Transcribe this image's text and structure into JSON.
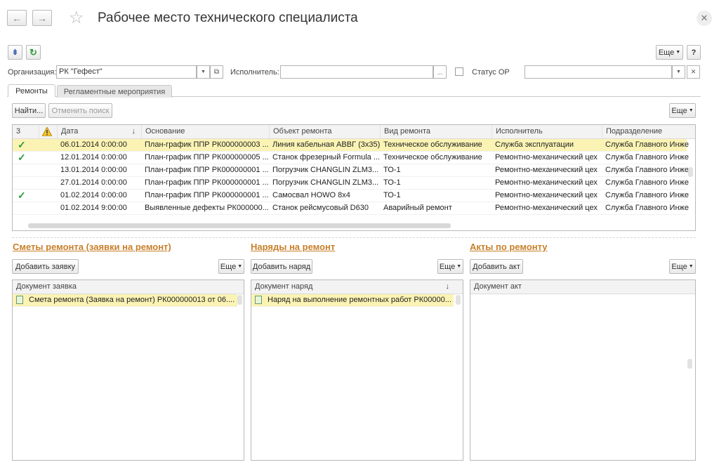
{
  "window": {
    "title": "Рабочее место технического специалиста",
    "more_label": "Еще",
    "help_label": "?"
  },
  "filters": {
    "organization_label": "Организация:",
    "organization_value": "РК \"Гефест\"",
    "executor_label": "Исполнитель:",
    "executor_value": "",
    "status_label": "Статус ОР",
    "status_value": ""
  },
  "tabs": [
    {
      "label": "Ремонты"
    },
    {
      "label": "Регламентные мероприятия"
    }
  ],
  "repairs": {
    "find_label": "Найти...",
    "cancel_search_label": "Отменить поиск",
    "more_label": "Еще",
    "columns": [
      "3",
      "",
      "Дата",
      "Основание",
      "Объект ремонта",
      "Вид ремонта",
      "Исполнитель",
      "Подразделение"
    ],
    "rows": [
      {
        "done": "✓",
        "date": "06.01.2014 0:00:00",
        "basis": "План-график ППР РК000000003 ...",
        "object": "Линия кабельная АВВГ (3х35)",
        "type": "Техническое обслуживание",
        "executor": "Служба эксплуатации",
        "dept": "Служба Главного Инженера"
      },
      {
        "done": "✓",
        "date": "12.01.2014 0:00:00",
        "basis": "План-график ППР РК000000005 ...",
        "object": "Станок фрезерный Formula ...",
        "type": "Техническое обслуживание",
        "executor": "Ремонтно-механический цех",
        "dept": "Служба Главного Инженера"
      },
      {
        "done": "",
        "date": "13.01.2014 0:00:00",
        "basis": "План-график ППР РК000000001 ...",
        "object": "Погрузчик CHANGLIN ZLM3...",
        "type": "ТО-1",
        "executor": "Ремонтно-механический цех",
        "dept": "Служба Главного Инженера"
      },
      {
        "done": "",
        "date": "27.01.2014 0:00:00",
        "basis": "План-график ППР РК000000001 ...",
        "object": "Погрузчик CHANGLIN ZLM3...",
        "type": "ТО-1",
        "executor": "Ремонтно-механический цех",
        "dept": "Служба Главного Инженера"
      },
      {
        "done": "✓",
        "date": "01.02.2014 0:00:00",
        "basis": "План-график ППР РК000000001 ...",
        "object": "Самосвал HOWO 8x4",
        "type": "ТО-1",
        "executor": "Ремонтно-механический цех",
        "dept": "Служба Главного Инженера"
      },
      {
        "done": "",
        "date": "01.02.2014 9:00:00",
        "basis": "Выявленные дефекты РК000000...",
        "object": "Станок рейсмусовый D630",
        "type": "Аварийный ремонт",
        "executor": "Ремонтно-механический цех",
        "dept": "Служба Главного Инженера"
      }
    ]
  },
  "estimates": {
    "title": "Сметы ремонта (заявки на ремонт)",
    "add_label": "Добавить заявку",
    "more_label": "Еще",
    "column": "Документ заявка",
    "rows": [
      "Смета ремонта (Заявка на ремонт) РК000000013 от 06...."
    ]
  },
  "orders": {
    "title": "Наряды на ремонт",
    "add_label": "Добавить наряд",
    "more_label": "Еще",
    "column": "Документ наряд",
    "rows": [
      "Наряд на выполнение ремонтных работ РК00000..."
    ]
  },
  "acts": {
    "title": "Акты по ремонту",
    "add_label": "Добавить акт",
    "more_label": "Еще",
    "column": "Документ акт",
    "rows": []
  },
  "colors": {
    "selected_row": "#fbf3b4",
    "section_title": "#c87f2a",
    "check": "#2e9a3c"
  }
}
